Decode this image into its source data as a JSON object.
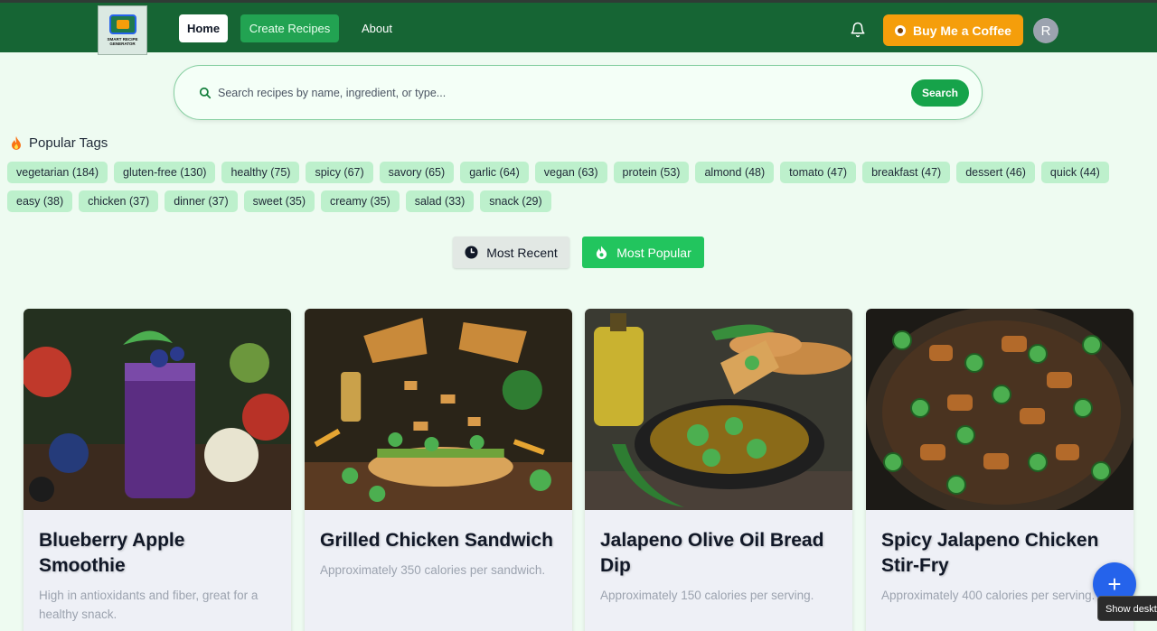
{
  "header": {
    "logo_text": "SMART RECIPE GENERATOR",
    "nav": {
      "home": "Home",
      "create": "Create Recipes",
      "about": "About"
    },
    "coffee_label": "Buy Me a Coffee",
    "avatar_initial": "R"
  },
  "search": {
    "placeholder": "Search recipes by name, ingredient, or type...",
    "button": "Search"
  },
  "tags": {
    "heading": "Popular Tags",
    "items": [
      "vegetarian (184)",
      "gluten-free (130)",
      "healthy (75)",
      "spicy (67)",
      "savory (65)",
      "garlic (64)",
      "vegan (63)",
      "protein (53)",
      "almond (48)",
      "tomato (47)",
      "breakfast (47)",
      "dessert (46)",
      "quick (44)",
      "easy (38)",
      "chicken (37)",
      "dinner (37)",
      "sweet (35)",
      "creamy (35)",
      "salad (33)",
      "snack (29)"
    ]
  },
  "sort": {
    "recent": "Most Recent",
    "popular": "Most Popular"
  },
  "recipes": [
    {
      "title": "Blueberry Apple Smoothie",
      "description": "High in antioxidants and fiber, great for a healthy snack."
    },
    {
      "title": "Grilled Chicken Sandwich",
      "description": "Approximately 350 calories per sandwich."
    },
    {
      "title": "Jalapeno Olive Oil Bread Dip",
      "description": "Approximately 150 calories per serving."
    },
    {
      "title": "Spicy Jalapeno Chicken Stir-Fry",
      "description": "Approximately 400 calories per serving."
    }
  ],
  "fab_label": "+",
  "tooltip": "Show desktop",
  "colors": {
    "header": "#166534",
    "accent": "#22c55e",
    "coffee": "#f59e0b",
    "tag": "#bdf0cc",
    "fab": "#2563eb"
  }
}
